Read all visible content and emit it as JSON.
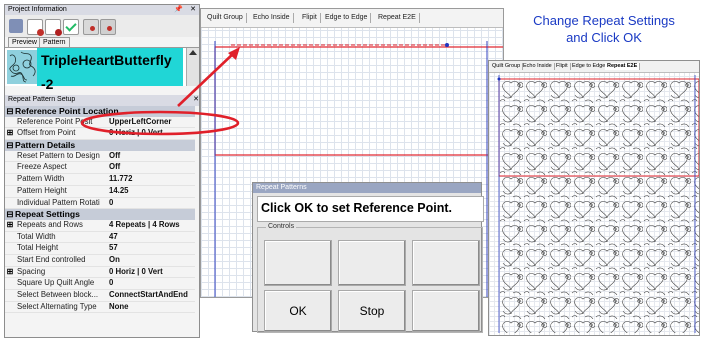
{
  "project_panel": {
    "title": "Project Information",
    "title_controls": "\b ×",
    "tabs": [
      "Preview",
      "Pattern"
    ],
    "pattern_name": "TripleHeartButterfly -2"
  },
  "repeat_panel": {
    "title": "Repeat Pattern Setup",
    "rows": [
      {
        "type": "category",
        "symbol": "⊟",
        "label": "Reference Point Location"
      },
      {
        "type": "prop",
        "label": "Reference Point Posit",
        "value": "UpperLeftCorner"
      },
      {
        "type": "prop",
        "expander": "⊞",
        "label": "Offset from Point",
        "value": "0 Horiz | 0 Vert"
      },
      {
        "type": "category",
        "symbol": "⊟",
        "label": "Pattern Details"
      },
      {
        "type": "prop",
        "label": "Reset Pattern to Design",
        "value": "Off"
      },
      {
        "type": "prop",
        "label": "Freeze Aspect",
        "value": "Off"
      },
      {
        "type": "prop",
        "label": "Pattern Width",
        "value": "11.772"
      },
      {
        "type": "prop",
        "label": "Pattern Height",
        "value": "14.25"
      },
      {
        "type": "prop",
        "label": "Individual Pattern Rotati",
        "value": "0"
      },
      {
        "type": "category",
        "symbol": "⊟",
        "label": "Repeat Settings"
      },
      {
        "type": "prop",
        "expander": "⊞",
        "label": "Repeats and Rows",
        "value": "4 Repeats | 4 Rows"
      },
      {
        "type": "prop",
        "label": "Total Width",
        "value": "47"
      },
      {
        "type": "prop",
        "label": "Total Height",
        "value": "57"
      },
      {
        "type": "prop",
        "label": "Start End controlled",
        "value": "On"
      },
      {
        "type": "prop",
        "expander": "⊞",
        "label": "Spacing",
        "value": "0 Horiz | 0 Vert"
      },
      {
        "type": "prop",
        "label": "Square Up Quilt Angle",
        "value": "0"
      },
      {
        "type": "prop",
        "label": "Select Between block...",
        "value": "ConnectStartAndEnd"
      },
      {
        "type": "prop",
        "label": "Select Alternating Type",
        "value": "None"
      }
    ]
  },
  "center_tabs": [
    "Quilt Group",
    "Echo Inside",
    "Flipit",
    "Edge to Edge",
    "Repeat E2E"
  ],
  "dialog": {
    "title": "Repeat Patterns",
    "message": "Click OK to set Reference Point.",
    "group_label": "Controls",
    "ok_label": "OK",
    "stop_label": "Stop"
  },
  "right_tabs": [
    "Quilt Group",
    "Echo Inside",
    "Flipit",
    "Edge to Edge",
    "Repeat E2E"
  ],
  "instruction": [
    "Change Repeat Settings",
    "and Click OK"
  ],
  "colors": {
    "highlight_red": "#e0202a",
    "instruction_blue": "#1a3ac4",
    "pattern_cyan": "#20d6d6"
  }
}
